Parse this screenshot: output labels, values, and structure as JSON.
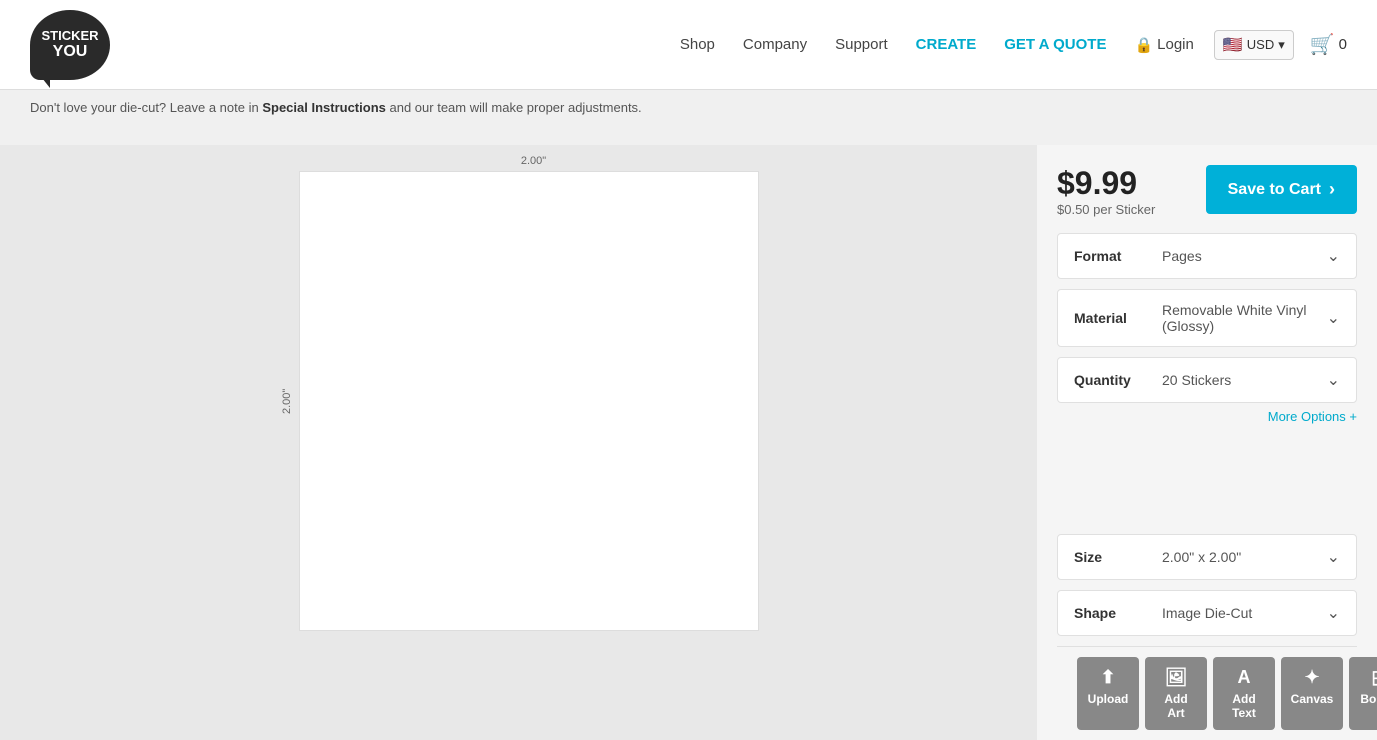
{
  "header": {
    "logo_line1": "STICKER",
    "logo_line2": "YOU",
    "nav_shop": "Shop",
    "nav_company": "Company",
    "nav_support": "Support",
    "nav_create": "CREATE",
    "nav_quote": "GET A QUOTE",
    "nav_login": "Login",
    "currency": "USD",
    "cart_count": "0"
  },
  "notice": {
    "text1": "Don't love your die-cut?",
    "text2": " Leave a note in ",
    "special": "Special Instructions",
    "text3": " and our team will make proper adjustments."
  },
  "canvas": {
    "dimension_top": "2.00\"",
    "dimension_left": "2.00\""
  },
  "pricing": {
    "price": "$9.99",
    "per_sticker": "$0.50 per Sticker",
    "save_button": "Save to Cart"
  },
  "options": {
    "format_label": "Format",
    "format_value": "Pages",
    "material_label": "Material",
    "material_value": "Removable White Vinyl (Glossy)",
    "quantity_label": "Quantity",
    "quantity_value": "20 Stickers",
    "more_options": "More Options +",
    "size_label": "Size",
    "size_value": "2.00\" x 2.00\"",
    "shape_label": "Shape",
    "shape_value": "Image Die-Cut"
  },
  "toolbar": {
    "upload_label": "Upload",
    "add_art_label": "Add Art",
    "add_text_label": "Add Text",
    "canvas_label": "Canvas",
    "border_label": "Border"
  },
  "colors": {
    "create": "#00aacc",
    "save_btn": "#00b0d8",
    "more_options": "#00aacc"
  }
}
